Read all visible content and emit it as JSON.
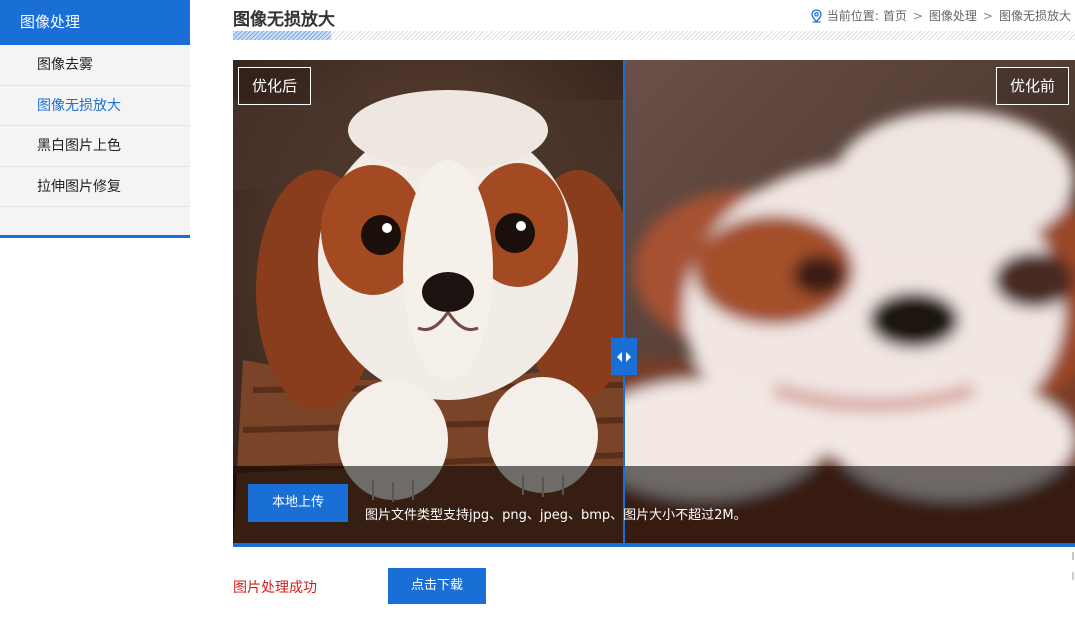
{
  "sidebar": {
    "title": "图像处理",
    "items": [
      {
        "label": "图像去雾",
        "active": false
      },
      {
        "label": "图像无损放大",
        "active": true
      },
      {
        "label": "黑白图片上色",
        "active": false
      },
      {
        "label": "拉伸图片修复",
        "active": false
      }
    ]
  },
  "header": {
    "title": "图像无损放大",
    "breadcrumb": {
      "prefix": "当前位置:",
      "items": [
        "首页",
        "图像处理",
        "图像无损放大"
      ],
      "separator": ">"
    }
  },
  "viewer": {
    "after_label": "优化后",
    "before_label": "优化前",
    "upload_button": "本地上传",
    "upload_hint": "图片文件类型支持jpg、png、jpeg、bmp、图片大小不超过2M。",
    "image_subject": "puppy-photo"
  },
  "result": {
    "status": "图片处理成功",
    "download_button": "点击下载"
  },
  "colors": {
    "accent": "#1a6fd6",
    "status": "#d21f1f",
    "sidebar_bg": "#f4f4f4"
  },
  "icons": {
    "breadcrumb": "location-pin-icon",
    "slider": "left-right-arrows-icon"
  }
}
